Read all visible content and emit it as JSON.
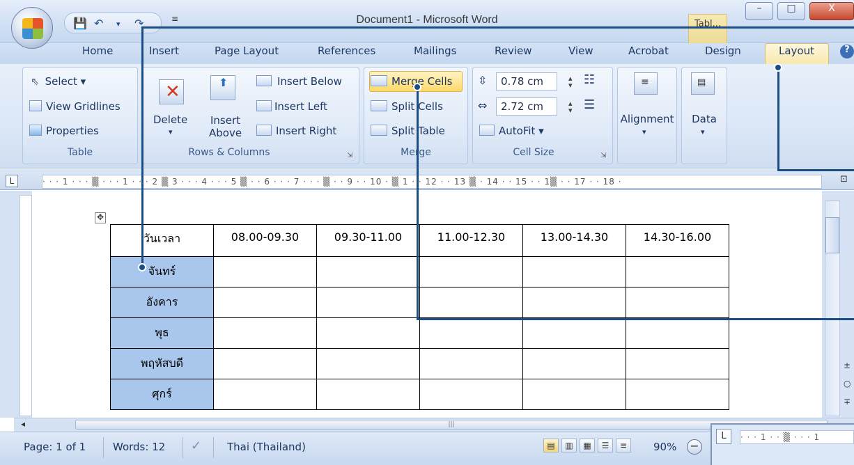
{
  "window": {
    "title": "Document1 - Microsoft Word",
    "context_tab_label": "Tabl...",
    "minimize": "–",
    "maximize": "□",
    "close": "X"
  },
  "qat": {
    "save": "💾",
    "undo": "↶",
    "redo": "↷",
    "more": "≡"
  },
  "tabs": [
    "Home",
    "Insert",
    "Page Layout",
    "References",
    "Mailings",
    "Review",
    "View",
    "Acrobat",
    "Design",
    "Layout"
  ],
  "active_tab": "Layout",
  "help": "?",
  "ribbon": {
    "table": {
      "label": "Table",
      "select": "Select ▾",
      "view_gridlines": "View Gridlines",
      "properties": "Properties"
    },
    "rows_columns": {
      "label": "Rows & Columns",
      "delete": "Delete",
      "delete_arrow": "▾",
      "insert_above_1": "Insert",
      "insert_above_2": "Above",
      "insert_below": "Insert Below",
      "insert_left": "Insert Left",
      "insert_right": "Insert Right"
    },
    "merge": {
      "label": "Merge",
      "merge_cells": "Merge Cells",
      "split_cells": "Split Cells",
      "split_table": "Split Table"
    },
    "cell_size": {
      "label": "Cell Size",
      "height": "0.78 cm",
      "width": "2.72 cm",
      "autofit": "AutoFit ▾"
    },
    "alignment": {
      "label": "Alignment",
      "arrow": "▾"
    },
    "data": {
      "label": "Data",
      "arrow": "▾"
    }
  },
  "ruler_text": "· · · 1 · · · ▒ · · · 1 · · · 2 ▒ 3 · · · 4 · · · 5 ▒ · · 6 · · · 7 · · · ▒ · · 9 · · 10 · ▒ 1 · · 12 · · 13 ▒ · 14 · · 15 · · 1▒ · · 17 · · 18 ·",
  "ruler_corner": "L",
  "schedule": {
    "header_corner": "วันเวลา",
    "time_slots": [
      "08.00-09.30",
      "09.30-11.00",
      "11.00-12.30",
      "13.00-14.30",
      "14.30-16.00"
    ],
    "days": [
      "จันทร์",
      "อังคาร",
      "พุธ",
      "พฤหัสบดี",
      "ศุกร์"
    ]
  },
  "statusbar": {
    "page": "Page: 1 of 1",
    "words": "Words: 12",
    "language": "Thai (Thailand)",
    "zoom": "90%",
    "zoom_minus": "−"
  },
  "inset": {
    "corner": "L",
    "ruler_text": "· · · 1 · · ▒ · · · 1"
  },
  "colors": {
    "callout": "#1a4d86",
    "day_cell": "#a9c7ec",
    "active_tab": "#f7e7a8"
  }
}
